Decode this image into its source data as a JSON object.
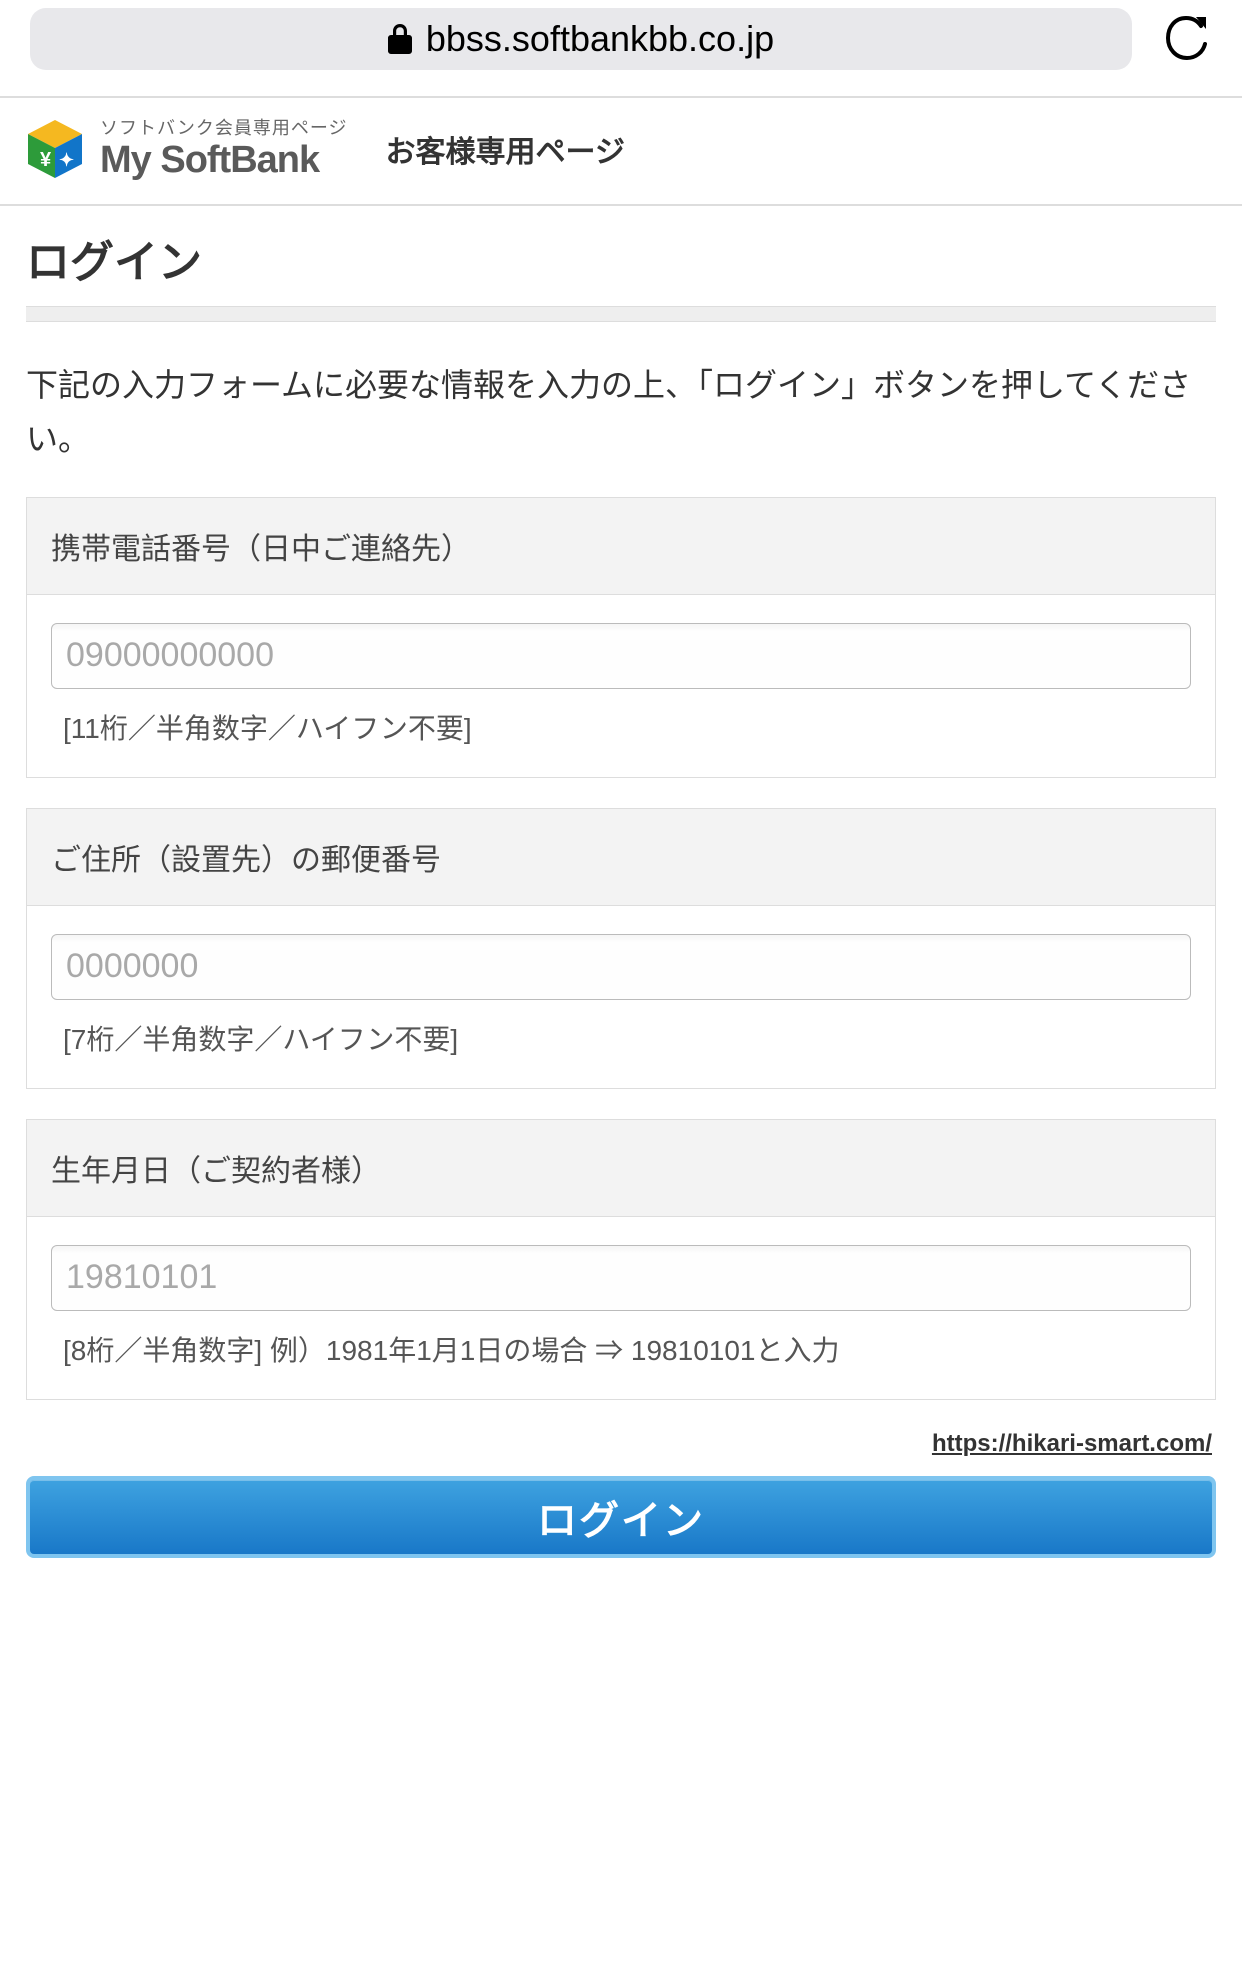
{
  "browser": {
    "url": "bbss.softbankbb.co.jp"
  },
  "brand": {
    "small": "ソフトバンク会員専用ページ",
    "main": "My SoftBank",
    "sub": "お客様専用ページ"
  },
  "page": {
    "title": "ログイン",
    "instruction": "下記の入力フォームに必要な情報を入力の上、「ログイン」ボタンを押してください。"
  },
  "fields": {
    "phone": {
      "label": "携帯電話番号（日中ご連絡先）",
      "placeholder": "09000000000",
      "hint": "[11桁／半角数字／ハイフン不要]"
    },
    "postal": {
      "label": "ご住所（設置先）の郵便番号",
      "placeholder": "0000000",
      "hint": "[7桁／半角数字／ハイフン不要]"
    },
    "birthdate": {
      "label": "生年月日（ご契約者様）",
      "placeholder": "19810101",
      "hint": "[8桁／半角数字]  例）1981年1月1日の場合 ⇒ 19810101と入力"
    }
  },
  "link": {
    "text": "https://hikari-smart.com/"
  },
  "actions": {
    "login": "ログイン"
  }
}
